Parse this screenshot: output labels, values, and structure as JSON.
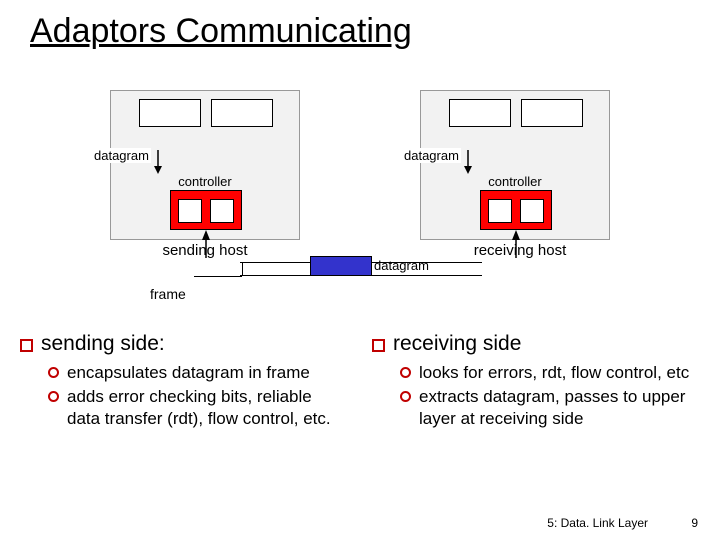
{
  "title": "Adaptors Communicating",
  "diagram": {
    "datagram_label": "datagram",
    "controller_label": "controller",
    "sending_host": "sending host",
    "receiving_host": "receiving host",
    "frame_datagram": "datagram",
    "frame_label": "frame"
  },
  "left": {
    "heading": "sending side:",
    "items": [
      "encapsulates datagram in frame",
      "adds error checking bits, reliable data transfer (rdt), flow control, etc."
    ]
  },
  "right": {
    "heading": "receiving side",
    "items": [
      "looks for errors, rdt, flow control, etc",
      "extracts datagram, passes to upper layer at receiving side"
    ]
  },
  "footer": {
    "section": "5: Data. Link Layer",
    "page": "9"
  }
}
